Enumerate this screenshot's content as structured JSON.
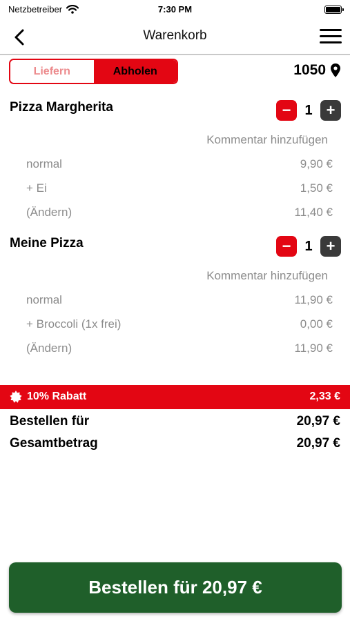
{
  "status_bar": {
    "carrier": "Netzbetreiber",
    "time": "7:30 PM"
  },
  "nav": {
    "title": "Warenkorb"
  },
  "delivery_toggle": {
    "option_delivery": "Liefern",
    "option_pickup": "Abholen",
    "selected": "Abholen"
  },
  "location": {
    "postal_code": "1050"
  },
  "cart": {
    "items": [
      {
        "name": "Pizza Margherita",
        "quantity": "1",
        "comment_link": "Kommentar hinzufügen",
        "lines": [
          {
            "label": "normal",
            "price": "9,90 €"
          },
          {
            "label": "+ Ei",
            "price": "1,50 €"
          },
          {
            "label": "(Ändern)",
            "price": "11,40 €"
          }
        ]
      },
      {
        "name": "Meine Pizza",
        "quantity": "1",
        "comment_link": "Kommentar hinzufügen",
        "lines": [
          {
            "label": "normal",
            "price": "11,90 €"
          },
          {
            "label": "+ Broccoli (1x frei)",
            "price": "0,00 €"
          },
          {
            "label": "(Ändern)",
            "price": "11,90 €"
          }
        ]
      }
    ]
  },
  "discount": {
    "label": "10% Rabatt",
    "amount": "2,33 €"
  },
  "totals": {
    "order_for_label": "Bestellen für",
    "order_for_value": "20,97 €",
    "grand_total_label": "Gesamtbetrag",
    "grand_total_value": "20,97 €"
  },
  "order_button": {
    "label": "Bestellen für 20,97 €"
  },
  "colors": {
    "accent_red": "#e30613",
    "order_green": "#1f5f2a",
    "muted_text": "#8c8c8c",
    "plus_button": "#3a3a3a"
  }
}
